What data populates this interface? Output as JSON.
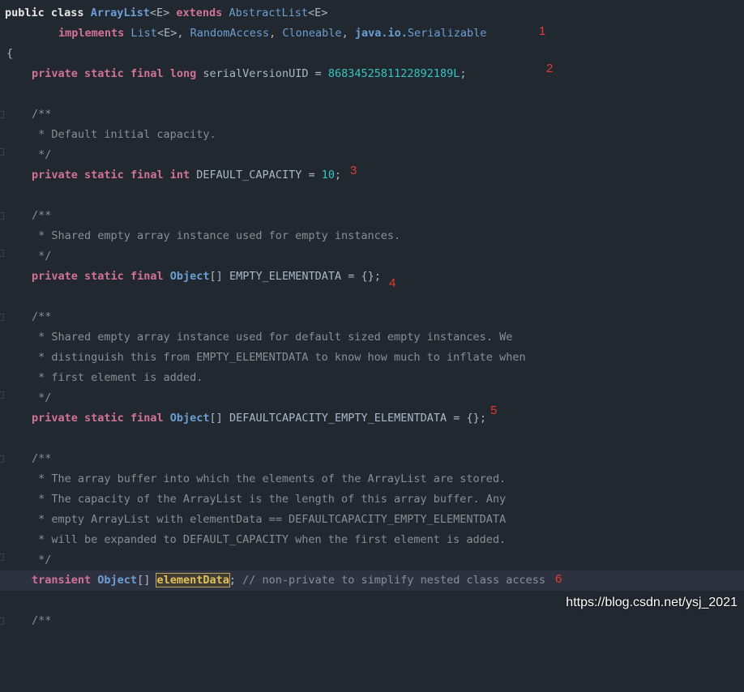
{
  "code": {
    "l1": {
      "public": "public",
      "class": "class",
      "name": "ArrayList",
      "gen": "<E>",
      "extends": "extends",
      "parent": "AbstractList",
      "gen2": "<E>"
    },
    "l2": {
      "implements": "implements",
      "i1": "List",
      "gen": "<E>",
      "sep1": ", ",
      "i2": "RandomAccess",
      "sep2": ", ",
      "i3": "Cloneable",
      "sep3": ", ",
      "pkg": "java.io.",
      "i4": "Serializable"
    },
    "l3": {
      "brace": "{"
    },
    "l4": {
      "private": "private",
      "static": "static",
      "final": "final",
      "type": "long",
      "name": "serialVersionUID",
      "eq": " = ",
      "value": "8683452581122892189L",
      "semi": ";"
    },
    "l6": "/**",
    "l7": " * Default initial capacity.",
    "l8": " */",
    "l9": {
      "private": "private",
      "static": "static",
      "final": "final",
      "type": "int",
      "name": "DEFAULT_CAPACITY",
      "eq": " = ",
      "value": "10",
      "semi": ";"
    },
    "l11": "/**",
    "l12": " * Shared empty array instance used for empty instances.",
    "l13": " */",
    "l14": {
      "private": "private",
      "static": "static",
      "final": "final",
      "type": "Object",
      "arr": "[]",
      "name": "EMPTY_ELEMENTDATA",
      "eq": " = ",
      "value": "{}",
      "semi": ";"
    },
    "l16": "/**",
    "l17": " * Shared empty array instance used for default sized empty instances. We",
    "l18": " * distinguish this from EMPTY_ELEMENTDATA to know how much to inflate when",
    "l19": " * first element is added.",
    "l20": " */",
    "l21": {
      "private": "private",
      "static": "static",
      "final": "final",
      "type": "Object",
      "arr": "[]",
      "name": "DEFAULTCAPACITY_EMPTY_ELEMENTDATA",
      "eq": " = ",
      "value": "{}",
      "semi": ";"
    },
    "l23": "/**",
    "l24": " * The array buffer into which the elements of the ArrayList are stored.",
    "l25": " * The capacity of the ArrayList is the length of this array buffer. Any",
    "l26": " * empty ArrayList with elementData == DEFAULTCAPACITY_EMPTY_ELEMENTDATA",
    "l27": " * will be expanded to DEFAULT_CAPACITY when the first element is added.",
    "l28": " */",
    "l29": {
      "transient": "transient",
      "type": "Object",
      "arr": "[]",
      "name": "elementData",
      "semi": ";",
      "comment": " // non-private to simplify nested class access"
    },
    "l31": "/**"
  },
  "annotations": [
    "1",
    "2",
    "3",
    "4",
    "5",
    "6"
  ],
  "watermark": "https://blog.csdn.net/ysj_2021",
  "colors": {
    "background": "#222830",
    "keyword": "#d17297",
    "class": "#6b9fd3",
    "number": "#33c6c4",
    "comment": "#8a8f96",
    "annotation": "#e23a32",
    "highlight": "#e0c05a"
  }
}
